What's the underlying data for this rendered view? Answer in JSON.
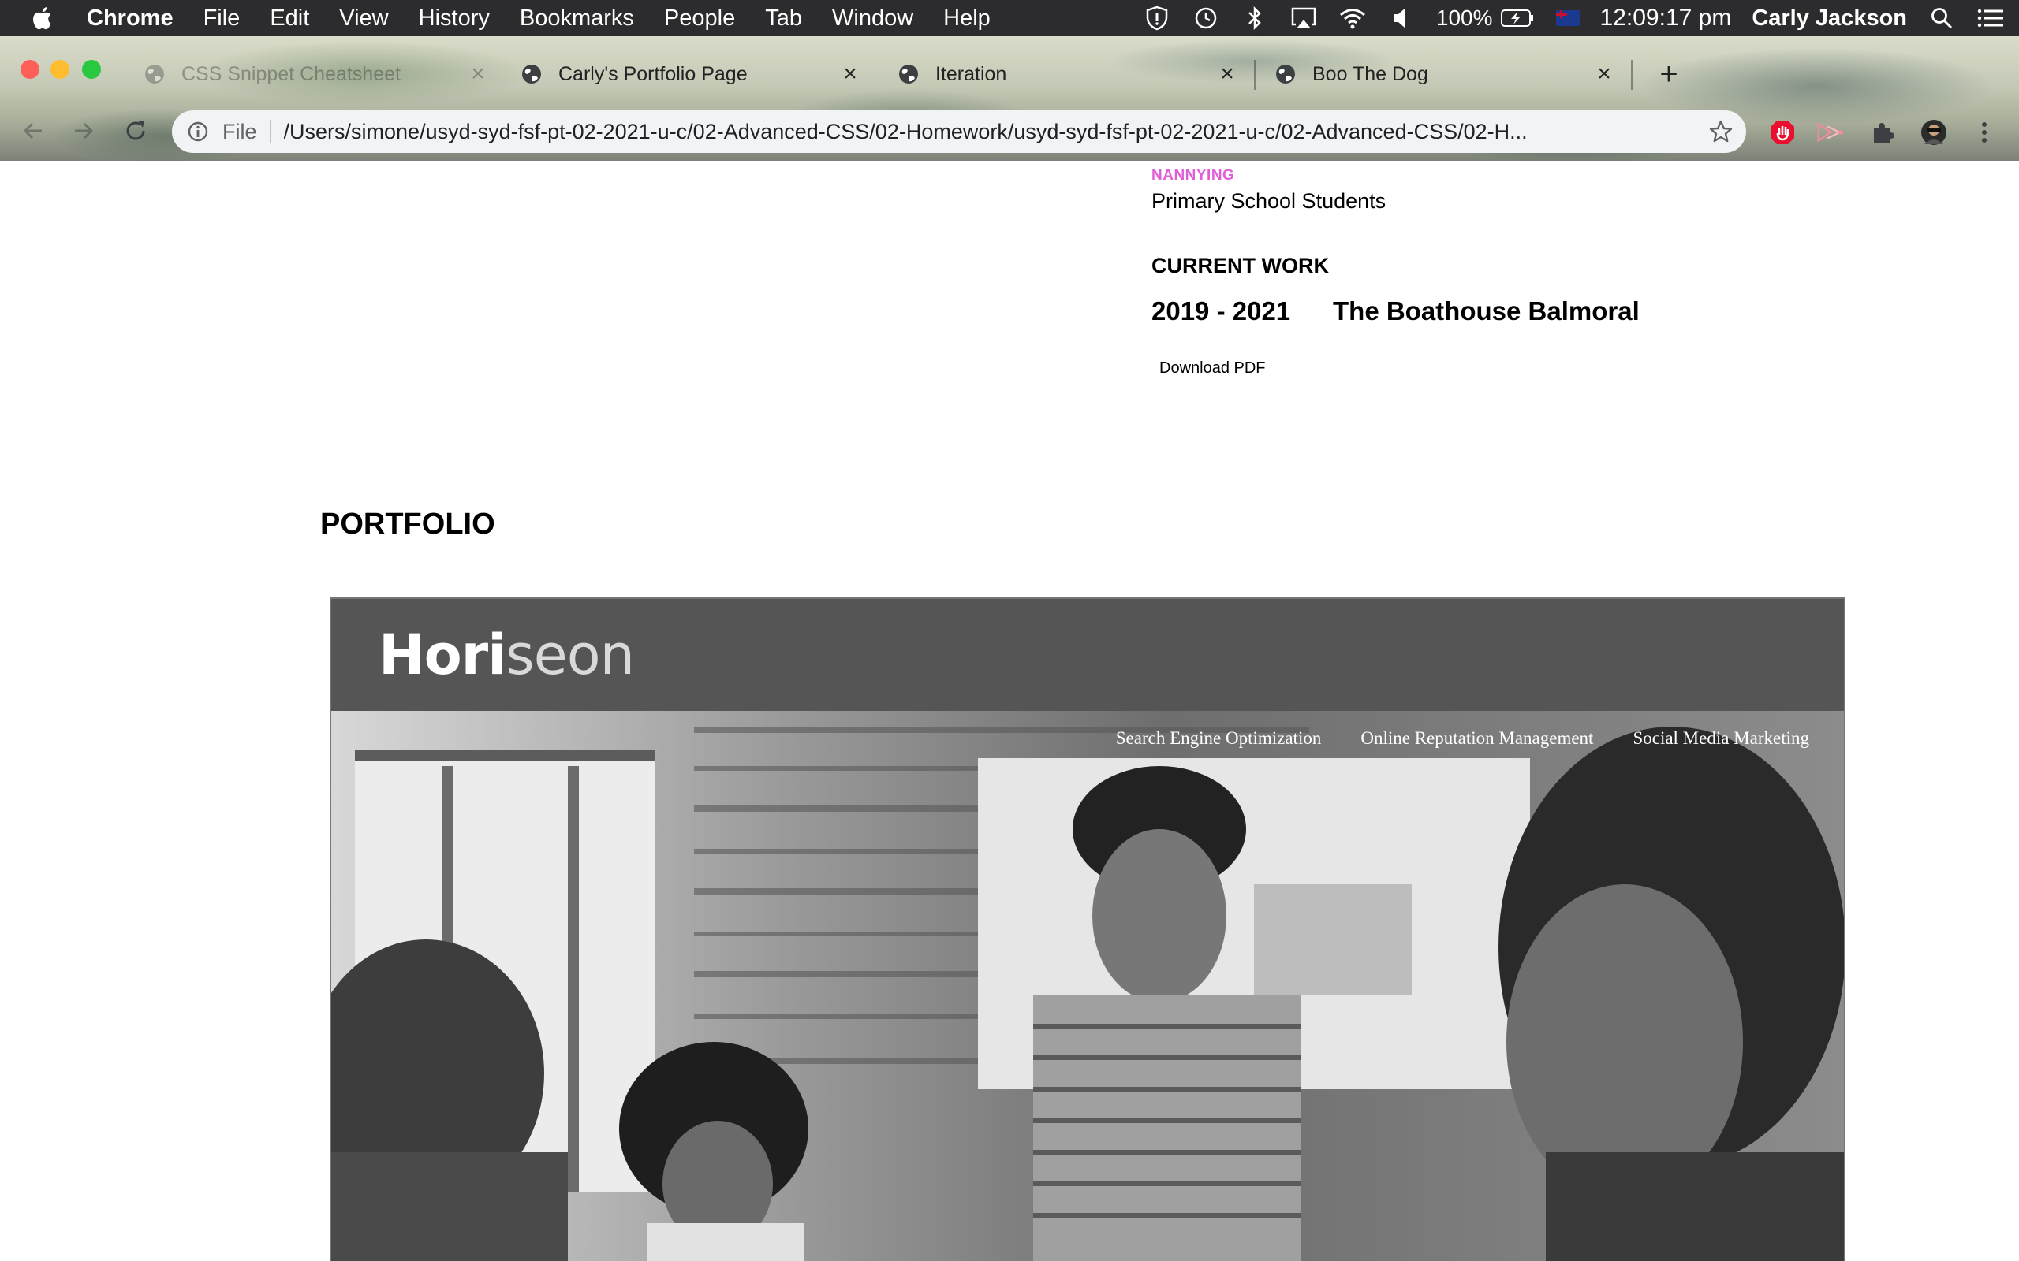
{
  "menubar": {
    "apple_icon": "apple-logo-icon",
    "app": "Chrome",
    "items": [
      "File",
      "Edit",
      "View",
      "History",
      "Bookmarks",
      "People",
      "Tab",
      "Window",
      "Help"
    ],
    "status_icons": [
      "vpn-shield-icon",
      "time-machine-icon",
      "bluetooth-icon",
      "airplay-icon",
      "wifi-icon",
      "volume-icon"
    ],
    "battery": "100%",
    "clock": "12:09:17 pm",
    "user": "Carly Jackson"
  },
  "browser": {
    "tabs": [
      {
        "title": "CSS Snippet Cheatsheet",
        "icon": "globe-icon"
      },
      {
        "title": "Carly's Portfolio Page",
        "icon": "globe-icon"
      },
      {
        "title": "Iteration",
        "icon": "globe-icon"
      },
      {
        "title": "Boo The Dog",
        "icon": "globe-icon"
      }
    ],
    "omnibox": {
      "scheme": "File",
      "url": "/Users/simone/usyd-syd-fsf-pt-02-2021-u-c/02-Advanced-CSS/02-Homework/usyd-syd-fsf-pt-02-2021-u-c/02-Advanced-CSS/02-H..."
    }
  },
  "page": {
    "nannying": {
      "label": "NANNYING",
      "value": "Primary School Students"
    },
    "current_work": {
      "title": "CURRENT WORK",
      "years": "2019 - 2021",
      "place": "The Boathouse Balmoral"
    },
    "download_label": "Download PDF",
    "portfolio_title": "PORTFOLIO",
    "project": {
      "logo_bold": "Hori",
      "logo_light": "seon",
      "nav": [
        "Search Engine Optimization",
        "Online Reputation Management",
        "Social Media Marketing"
      ]
    }
  },
  "colors": {
    "section_label": "#e05fd6",
    "menubar_bg": "#2c2c2e",
    "project_header_bg": "#555555"
  }
}
